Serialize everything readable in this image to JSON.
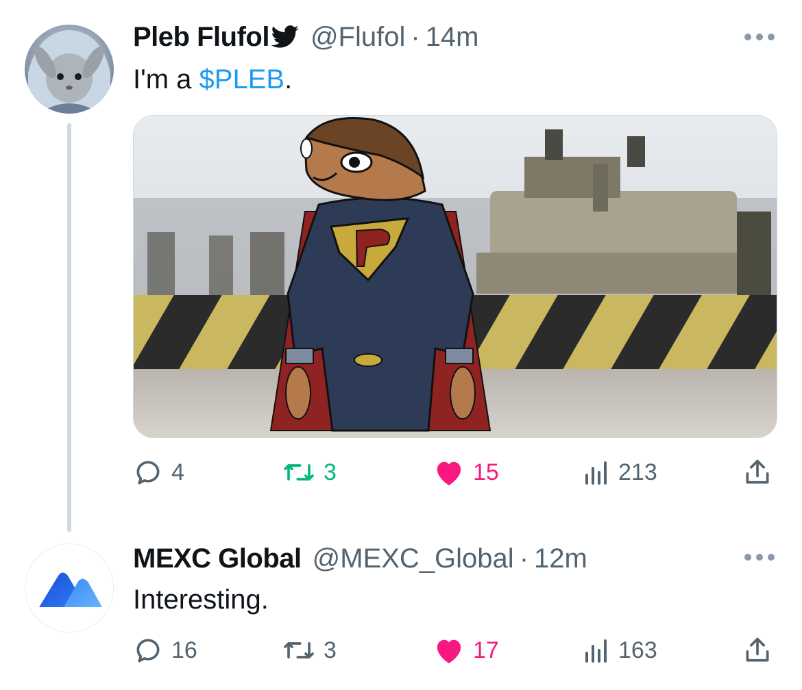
{
  "tweet1": {
    "display_name": "Pleb Flufol",
    "handle": "@Flufol",
    "separator": "·",
    "time": "14m",
    "text_prefix": "I'm a ",
    "cashtag": "$PLEB",
    "text_suffix": ".",
    "actions": {
      "replies": "4",
      "retweets": "3",
      "likes": "15",
      "views": "213"
    }
  },
  "tweet2": {
    "display_name": "MEXC Global",
    "handle": "@MEXC_Global",
    "separator": "·",
    "time": "12m",
    "text": "Interesting.",
    "actions": {
      "replies": "16",
      "retweets": "3",
      "likes": "17",
      "views": "163"
    }
  },
  "colors": {
    "text": "#0f1419",
    "secondary": "#536471",
    "link": "#1d9bf0",
    "retweet": "#00ba7c",
    "like": "#f91880",
    "thread_line": "#cfd9de"
  },
  "icons": [
    "twitter-bird-icon",
    "more-icon",
    "reply-icon",
    "retweet-icon",
    "like-icon",
    "views-icon",
    "share-icon"
  ]
}
